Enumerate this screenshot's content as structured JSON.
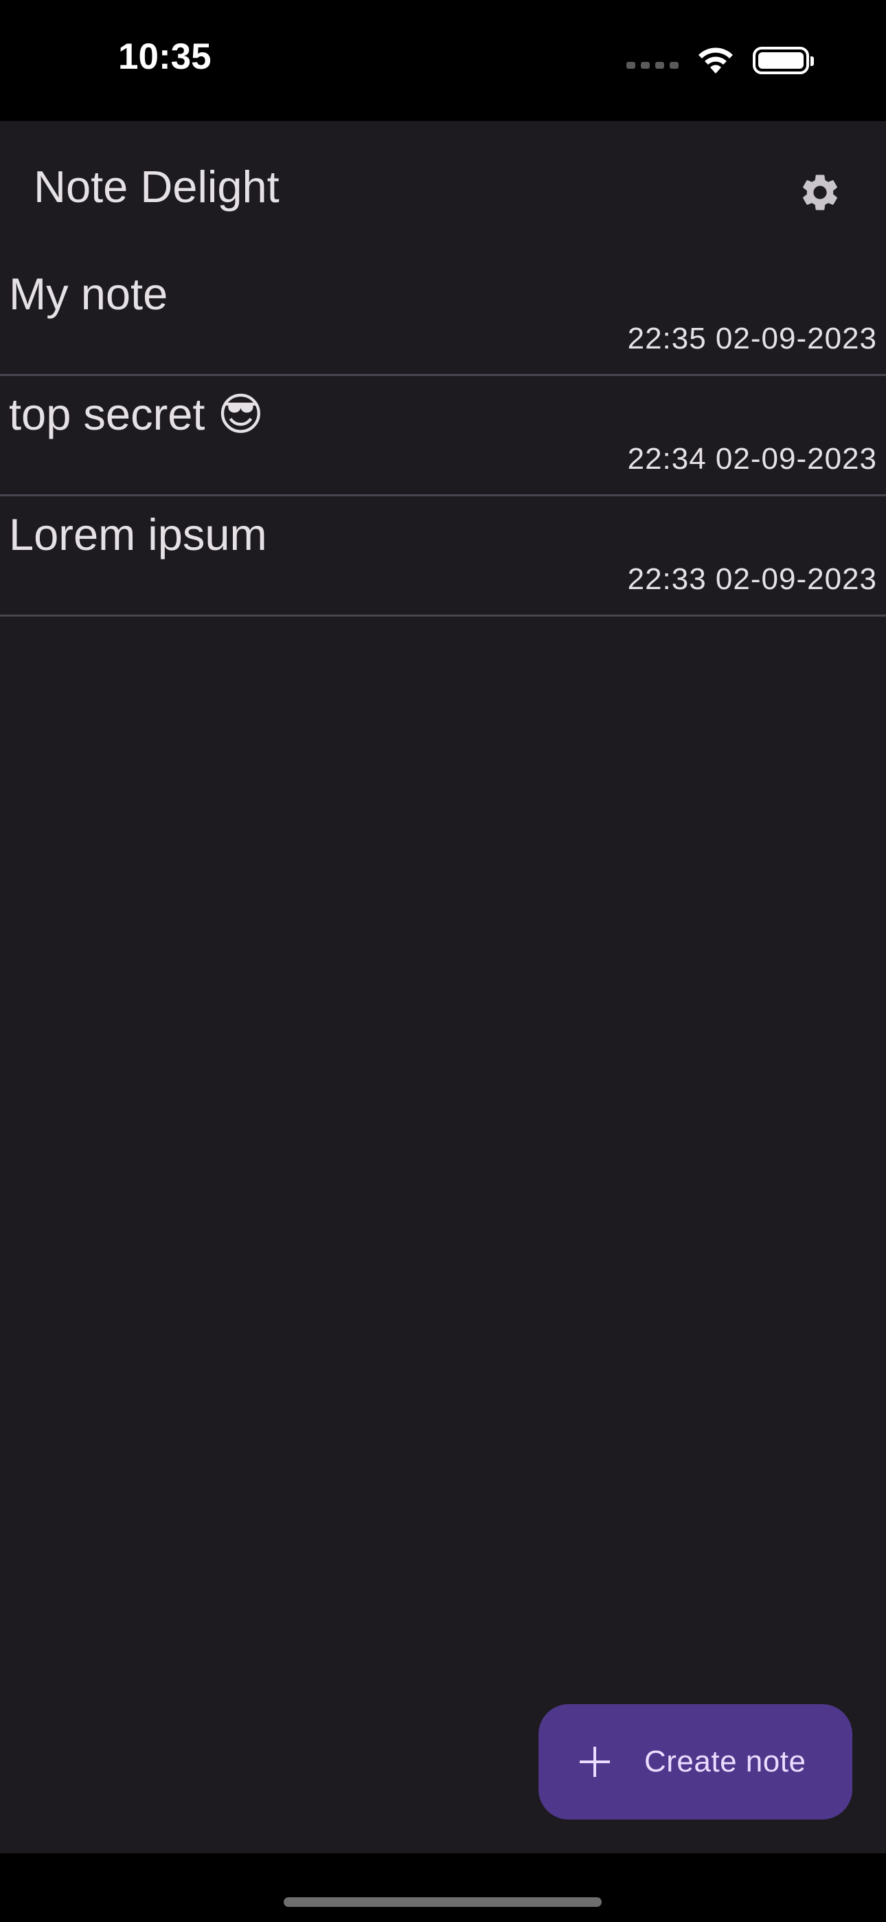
{
  "status_bar": {
    "time": "10:35",
    "icons": [
      "signal-icon",
      "wifi-icon",
      "battery-icon"
    ]
  },
  "app_bar": {
    "title": "Note Delight",
    "settings_icon": "gear-icon"
  },
  "notes": [
    {
      "title": "My note",
      "date": "22:35 02-09-2023"
    },
    {
      "title": "top secret 😎",
      "date": "22:34 02-09-2023"
    },
    {
      "title": "Lorem ipsum",
      "date": "22:33 02-09-2023"
    }
  ],
  "fab": {
    "icon": "plus-icon",
    "label": "Create note"
  },
  "colors": {
    "background": "#1d1b20",
    "surface_text": "#e6e1e5",
    "divider": "#49454f",
    "fab_background": "#4f378b",
    "fab_text": "#eaddff"
  }
}
